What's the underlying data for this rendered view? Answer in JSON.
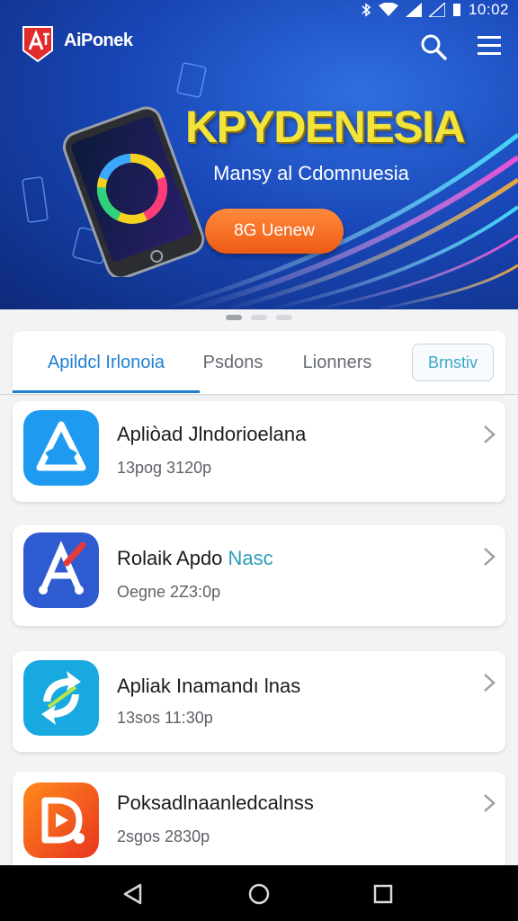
{
  "status_bar": {
    "time": "10:02"
  },
  "app_bar": {
    "brand": "AiPonek"
  },
  "hero": {
    "title": "KPYDENESIA",
    "subtitle": "Mansy al Cdomnuesia",
    "cta_label": "8G Uenew"
  },
  "carousel": {
    "count": 3,
    "active_index": 0
  },
  "tabs": [
    {
      "label": "Apildcl Irlonoia",
      "active": true
    },
    {
      "label": "Psdons",
      "active": false
    },
    {
      "label": "Lionners",
      "active": false
    }
  ],
  "filter_label": "Brnstiv",
  "apps": [
    {
      "title": "Apliòad Jlndorioelana",
      "title_accent": "",
      "meta": "13pog 3120p",
      "icon": "a-triangle-icon",
      "color": "#1e9bf0"
    },
    {
      "title": "Rolaik Apdo ",
      "title_accent": "Nasc",
      "meta": "Oegne 2Z3:0p",
      "icon": "a-pen-icon",
      "color": "#2f5bd1"
    },
    {
      "title": "Apliak Inamandı lnas",
      "title_accent": "",
      "meta": "13sos 11:30p",
      "icon": "sync-arrows-icon",
      "color": "#18a9e0"
    },
    {
      "title": "Poksadlnaanledcalnss",
      "title_accent": "",
      "meta": "2sgos 2830p",
      "icon": "play-pen-icon",
      "color": "#f26a1b"
    }
  ]
}
